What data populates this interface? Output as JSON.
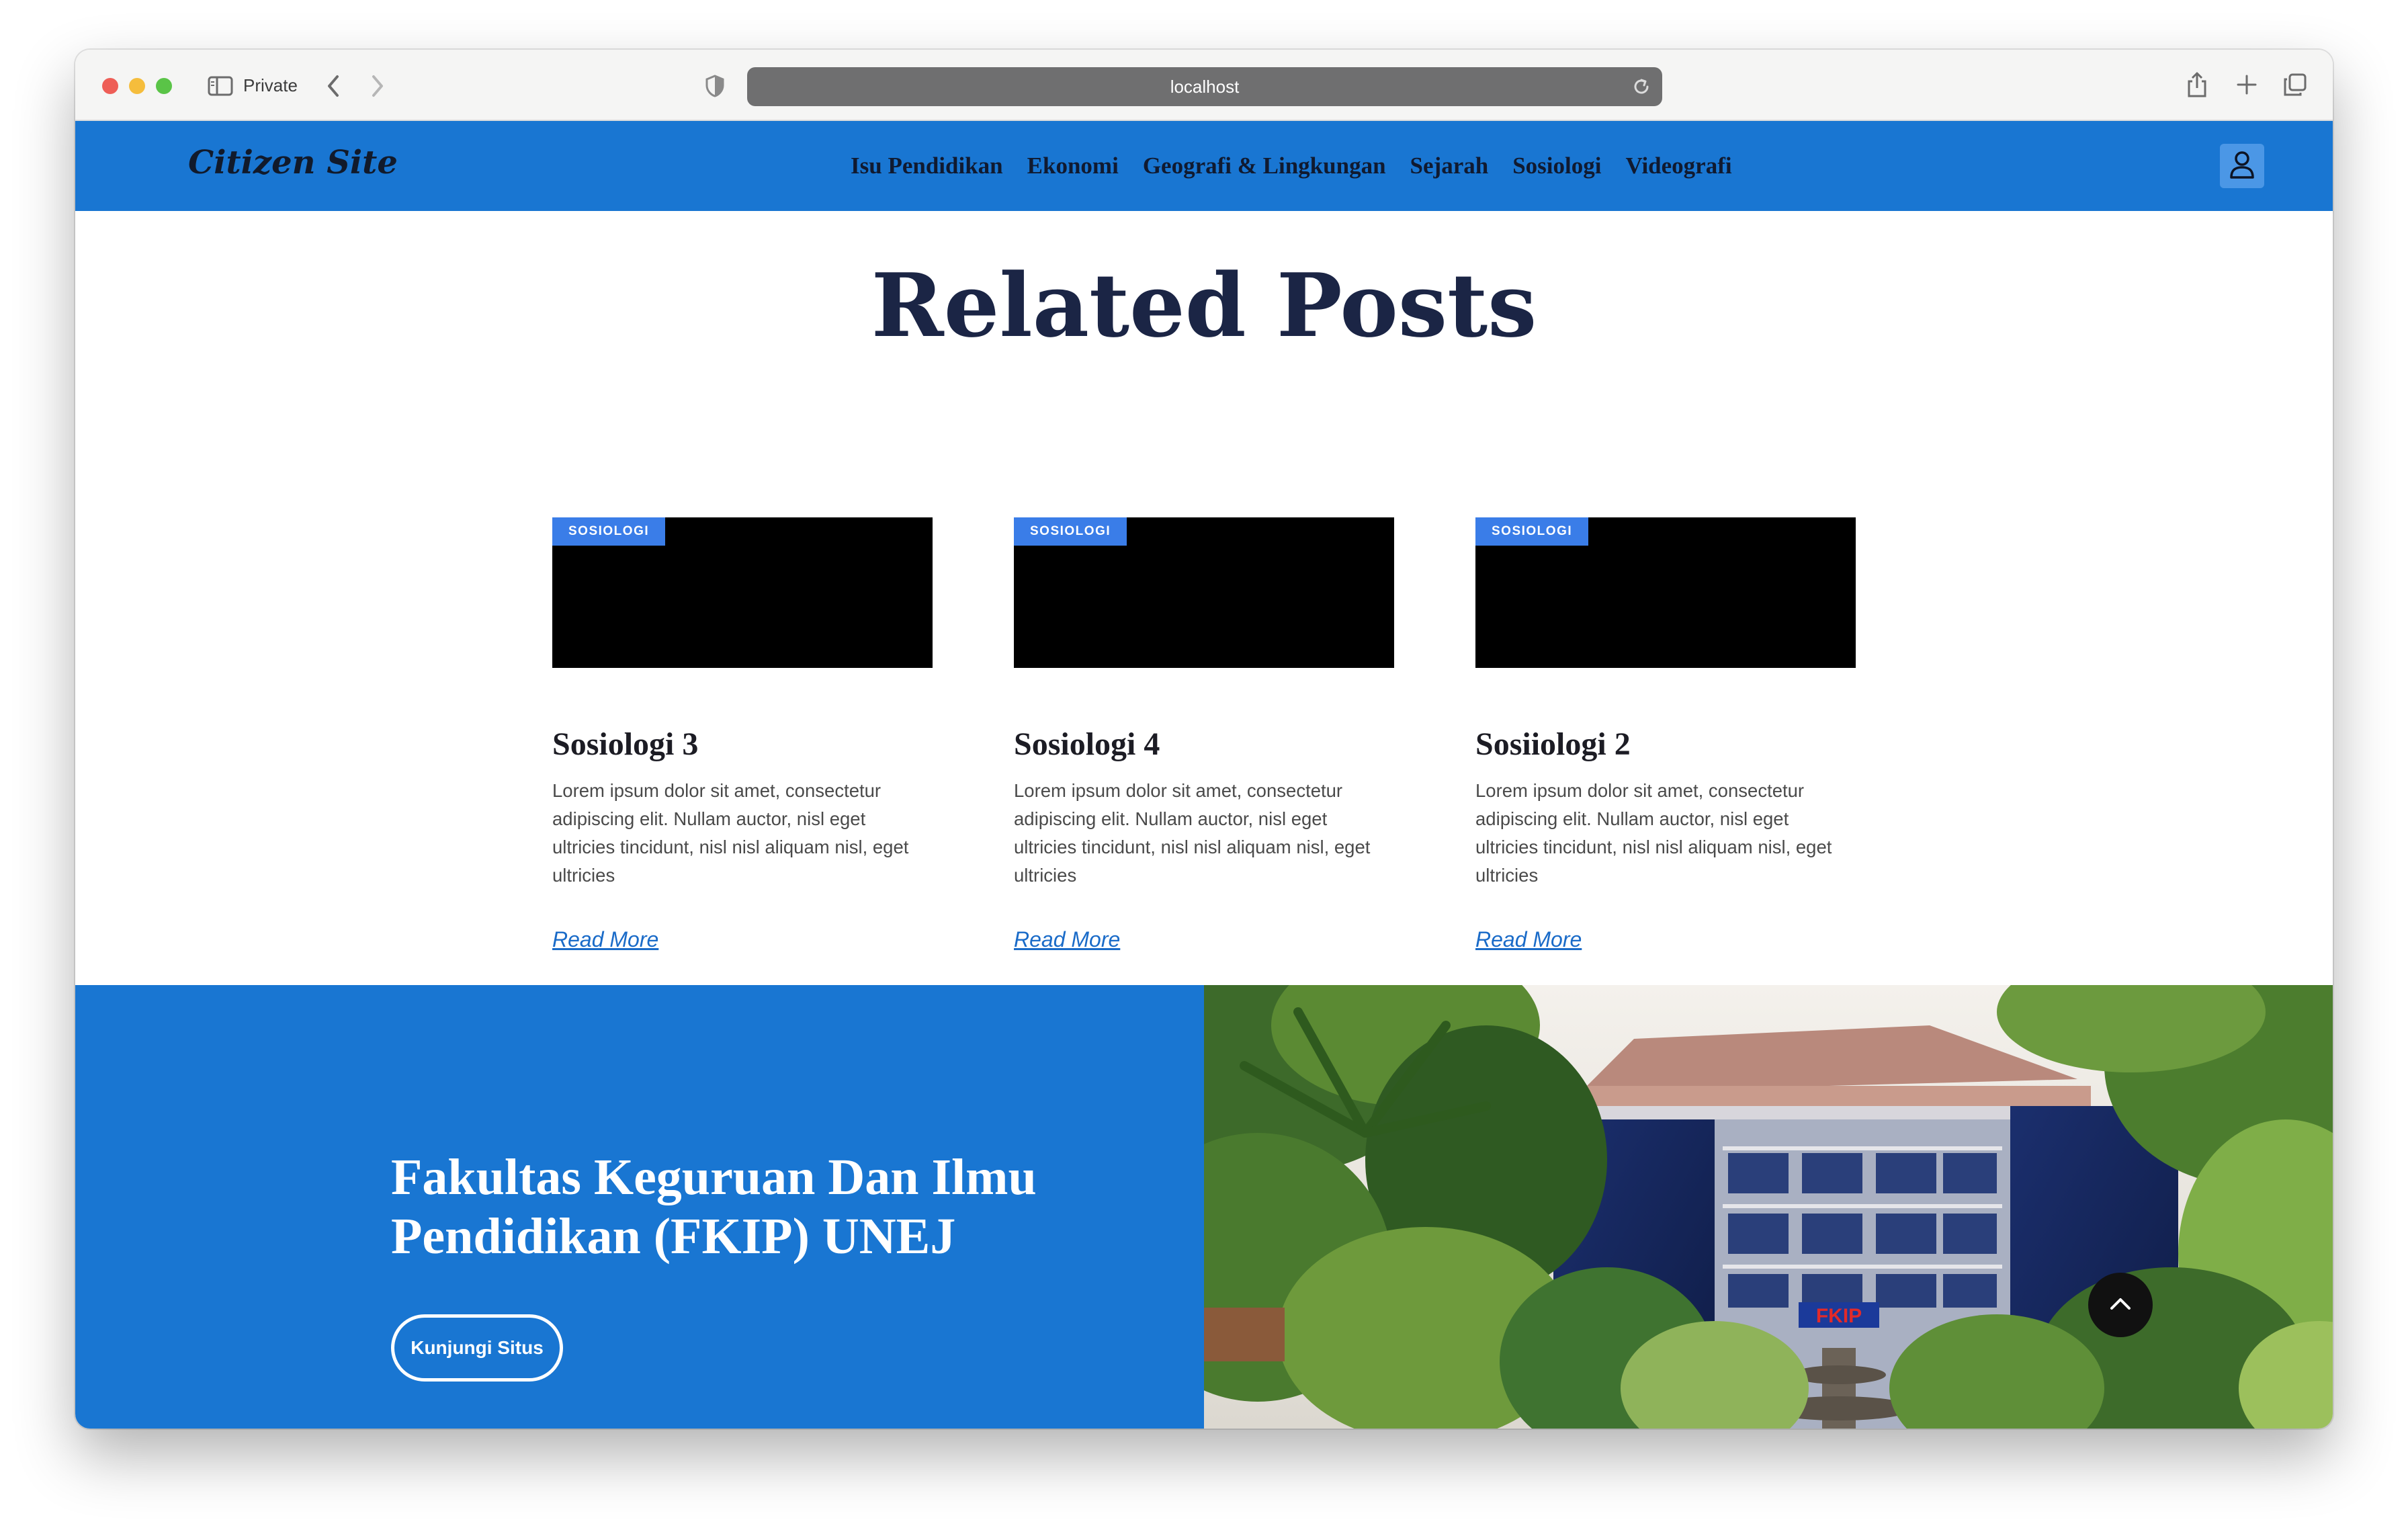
{
  "browser": {
    "private_label": "Private",
    "url": "localhost"
  },
  "site": {
    "logo": "Citizen Site",
    "nav": [
      "Isu Pendidikan",
      "Ekonomi",
      "Geografi & Lingkungan",
      "Sejarah",
      "Sosiologi",
      "Videografi"
    ]
  },
  "related": {
    "title": "Related Posts",
    "posts": [
      {
        "category": "SOSIOLOGI",
        "title": "Sosiologi 3",
        "excerpt": "Lorem ipsum dolor sit amet, consectetur adipiscing elit. Nullam auctor, nisl eget ultricies tincidunt, nisl nisl aliquam nisl, eget ultricies",
        "link": "Read More"
      },
      {
        "category": "SOSIOLOGI",
        "title": "Sosiologi 4",
        "excerpt": "Lorem ipsum dolor sit amet, consectetur adipiscing elit. Nullam auctor, nisl eget ultricies tincidunt, nisl nisl aliquam nisl, eget ultricies",
        "link": "Read More"
      },
      {
        "category": "SOSIOLOGI",
        "title": "Sosiiologi 2",
        "excerpt": "Lorem ipsum dolor sit amet, consectetur adipiscing elit. Nullam auctor, nisl eget ultricies tincidunt, nisl nisl aliquam nisl, eget ultricies",
        "link": "Read More"
      }
    ]
  },
  "banner": {
    "heading": "Fakultas Keguruan Dan Ilmu Pendidikan (FKIP) UNEJ",
    "button": "Kunjungi Situs",
    "photo_sign": "FKIP"
  },
  "colors": {
    "brand_blue": "#1976d2",
    "badge_blue": "#3a7de8",
    "title_navy": "#1b2545"
  }
}
